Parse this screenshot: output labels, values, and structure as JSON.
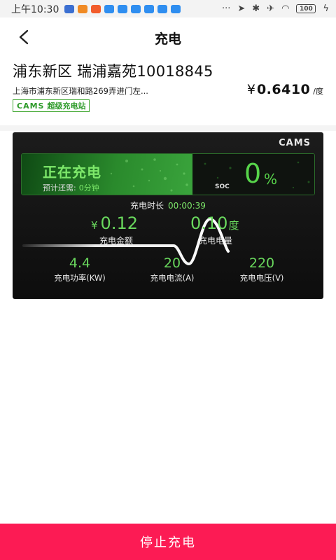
{
  "status_bar": {
    "time": "上午10:30",
    "app_icons": [
      "#3b6fd1",
      "#f08a24",
      "#f25c2b",
      "#2f8ef0",
      "#2f8ef0",
      "#2f8ef0",
      "#2f8ef0",
      "#2f8ef0",
      "#2f8ef0"
    ],
    "more": "···",
    "battery": "100"
  },
  "nav": {
    "title": "充电"
  },
  "station": {
    "name": "浦东新区 瑞浦嘉苑10018845",
    "address": "上海市浦东新区瑞和路269弄进门左...",
    "price_symbol": "¥",
    "price": "0.6410",
    "price_unit": "/度",
    "brand": "CAMS",
    "brand_label": "超级充电站"
  },
  "card": {
    "logo": "CAMS",
    "status": "正在充电",
    "remain_label": "预计还需:",
    "remain_value": "0分钟",
    "soc_label": "SOC",
    "soc_value": "0",
    "soc_unit": "%",
    "duration_label": "充电时长",
    "duration_value": "00:00:39",
    "amount_symbol": "¥",
    "amount_value": "0.12",
    "amount_label": "充电金额",
    "energy_value": "0.10",
    "energy_unit": "度",
    "energy_label": "充电电量",
    "metrics": [
      {
        "value": "4.4",
        "label": "充电功率(KW)"
      },
      {
        "value": "20",
        "label": "充电电流(A)"
      },
      {
        "value": "220",
        "label": "充电电压(V)"
      }
    ]
  },
  "actions": {
    "stop_label": "停止充电"
  },
  "colors": {
    "accent_green": "#69d85d",
    "stop_red": "#fc1b54"
  }
}
